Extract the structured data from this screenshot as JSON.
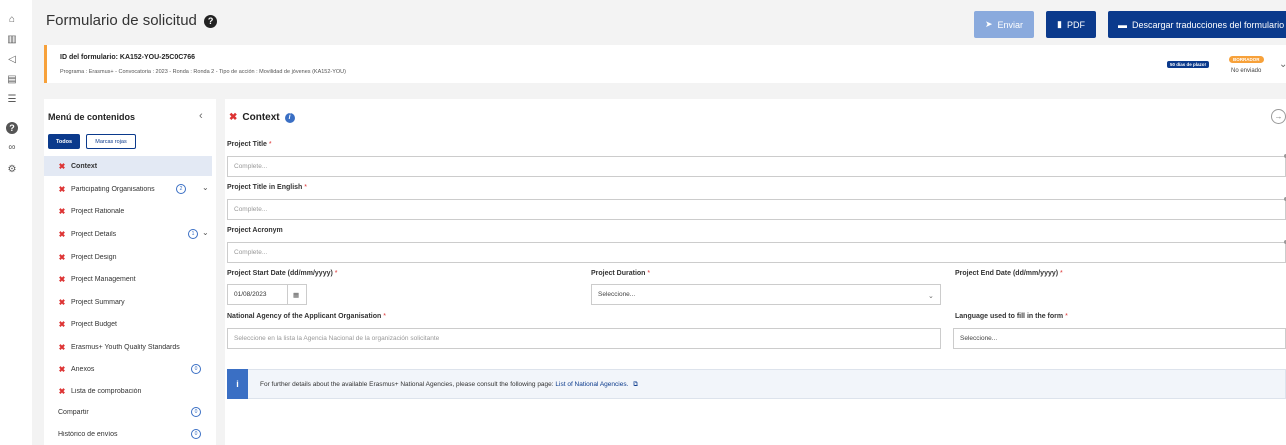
{
  "rail_icons": [
    {
      "name": "home-icon",
      "glyph": "⌂"
    },
    {
      "name": "institution-icon",
      "glyph": "▥"
    },
    {
      "name": "megaphone-icon",
      "glyph": "◁"
    },
    {
      "name": "document-icon",
      "glyph": "▤"
    },
    {
      "name": "list-icon",
      "glyph": "☰"
    },
    {
      "name": "help-icon",
      "glyph": "?"
    },
    {
      "name": "link-icon",
      "glyph": "∞"
    },
    {
      "name": "settings-icon",
      "glyph": "⚙"
    }
  ],
  "header": {
    "title": "Formulario de solicitud",
    "help_icon": "question-circle-icon",
    "buttons": {
      "enviar": "Enviar",
      "pdf": "PDF",
      "descargar": "Descargar traducciones del formulario"
    }
  },
  "form_info": {
    "id_label": "ID del formulario: KA152-YOU-25C0C766",
    "details": "Programa : Erasmus+ - Convocatoria : 2023 - Ronda : Ronda 2 - Tipo de acción : Movilidad de jóvenes (KA152-YOU)",
    "deadline_badge": "50 días de plazo!",
    "status_badge": "BORRADOR",
    "status_text": "No enviado"
  },
  "sidebar": {
    "title": "Menú de contenidos",
    "filters": {
      "all": "Todos",
      "red_flags": "Marcas rojas"
    },
    "items": [
      {
        "label": "Context",
        "error": true,
        "active": true
      },
      {
        "label": "Participating Organisations",
        "error": true,
        "count": "2",
        "expandable": true
      },
      {
        "label": "Project Rationale",
        "error": true
      },
      {
        "label": "Project Details",
        "error": true,
        "count": "1",
        "expandable": true
      },
      {
        "label": "Project Design",
        "error": true
      },
      {
        "label": "Project Management",
        "error": true
      },
      {
        "label": "Project Summary",
        "error": true
      },
      {
        "label": "Project Budget",
        "error": true
      },
      {
        "label": "Erasmus+ Youth Quality Standards",
        "error": true
      },
      {
        "label": "Anexos",
        "error": true,
        "count": "0"
      },
      {
        "label": "Lista de comprobación",
        "error": true
      },
      {
        "label": "Compartir",
        "error": false,
        "count": "0"
      },
      {
        "label": "Histórico de envíos",
        "error": false,
        "count": "0"
      }
    ]
  },
  "content": {
    "section_title": "Context",
    "fields": {
      "project_title": {
        "label": "Project Title",
        "placeholder": "Complete..."
      },
      "project_title_en": {
        "label": "Project Title in English",
        "placeholder": "Complete..."
      },
      "project_acronym": {
        "label": "Project Acronym",
        "placeholder": "Complete..."
      },
      "start_date": {
        "label": "Project Start Date (dd/mm/yyyy)",
        "value": "01/08/2023"
      },
      "duration": {
        "label": "Project Duration",
        "placeholder": "Seleccione..."
      },
      "end_date": {
        "label": "Project End Date (dd/mm/yyyy)"
      },
      "national_agency": {
        "label": "National Agency of the Applicant Organisation",
        "placeholder": "Seleccione en la lista la Agencia Nacional de la organización solicitante"
      },
      "language": {
        "label": "Language used to fill in the form",
        "placeholder": "Seleccione..."
      }
    },
    "note": {
      "text": "For further details about the available Erasmus+ National Agencies, please consult the following page:",
      "link": "List of National Agencies."
    }
  },
  "colors": {
    "primary": "#0b3a8c",
    "accent_orange": "#f7a13a",
    "error_red": "#d33",
    "info_blue": "#3a6fc4"
  }
}
